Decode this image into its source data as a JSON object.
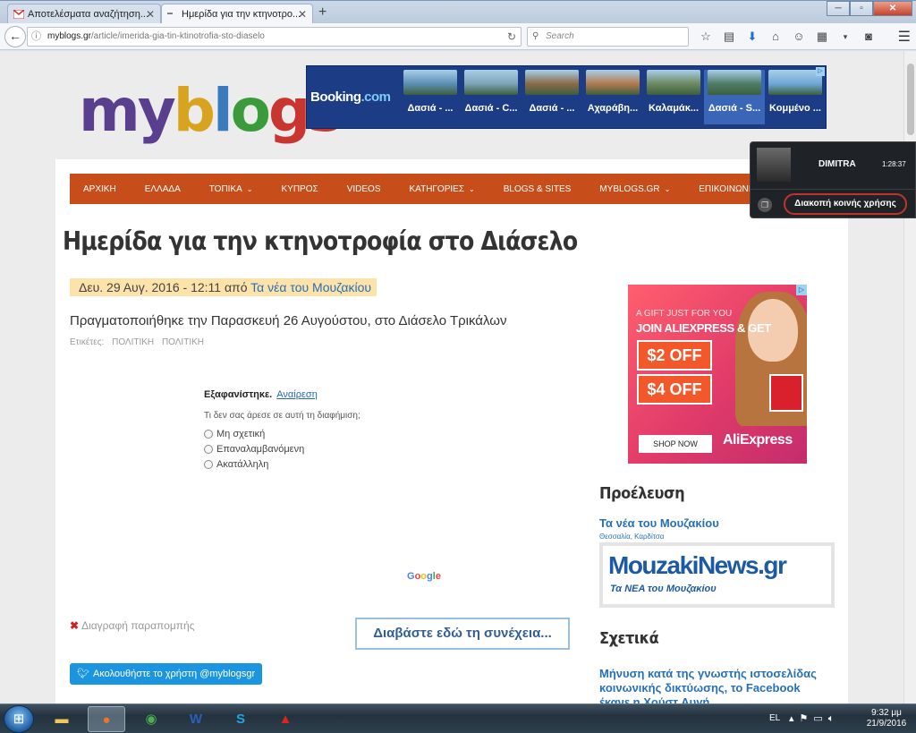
{
  "browser": {
    "tabs": [
      {
        "title": "Αποτελέσματα αναζήτηση...",
        "active": false
      },
      {
        "title": "Ημερίδα για την κτηνοτρο...",
        "active": true
      }
    ],
    "new_tab": "+",
    "url_domain": "myblogs.gr",
    "url_path": "/article/imerida-gia-tin-ktinotrofia-sto-diaselo",
    "search_placeholder": "Search",
    "window_buttons": [
      "─",
      "▫",
      "✕"
    ]
  },
  "site": {
    "logo_parts": [
      "my",
      "b",
      "l",
      "o",
      "gs"
    ]
  },
  "booking_ad": {
    "brand_main": "Booking",
    "brand_tld": ".com",
    "hotels": [
      {
        "label": "Δασιά - ...",
        "color": "#5d8fb5"
      },
      {
        "label": "Δασιά - C...",
        "color": "#7da4b8"
      },
      {
        "label": "Δασιά - ...",
        "color": "#8b6b4a"
      },
      {
        "label": "Αχαράβη...",
        "color": "#b47a4f"
      },
      {
        "label": "Καλαμάκ...",
        "color": "#6d8a62"
      },
      {
        "label": "Δασιά - S...",
        "color": "#4f7d6a"
      },
      {
        "label": "Κομμένο ...",
        "color": "#6fa8d8"
      }
    ]
  },
  "nav": {
    "items": [
      {
        "label": "ΑΡΧΙΚΗ",
        "dropdown": false
      },
      {
        "label": "ΕΛΛΑΔΑ",
        "dropdown": false
      },
      {
        "label": "ΤΟΠΙΚΑ",
        "dropdown": true
      },
      {
        "label": "ΚΥΠΡΟΣ",
        "dropdown": false
      },
      {
        "label": "VIDEOS",
        "dropdown": false
      },
      {
        "label": "ΚΑΤΗΓΟΡΙΕΣ",
        "dropdown": true
      },
      {
        "label": "BLOGS & SITES",
        "dropdown": false
      },
      {
        "label": "MYBLOGS.GR",
        "dropdown": true
      },
      {
        "label": "ΕΠΙΚΟΙΝΩΝΙΑ",
        "dropdown": false
      }
    ]
  },
  "article": {
    "title": "Ημερίδα για την κτηνοτροφία στο Διάσελο",
    "date_prefix": "Δευ. 29 Αυγ. 2016 - 12:11 από ",
    "source": "Τα νέα του Μουζακίου",
    "lead": "Πραγματοποιήθηκε την Παρασκευή 26 Αυγούστου, στο Διάσελο Τρικάλων",
    "tags_label": "Ετικέτες:",
    "tags": [
      "ΠΟΛΙΤΙΚΗ",
      "ΠΟΛΙΤΙΚΗ"
    ],
    "remove_link": "Διαγραφή παραπομπής",
    "read_more": "Διαβάστε εδώ τη συνέχεια...",
    "twitter_follow": "Ακολουθήστε το χρήστη @myblogsgr"
  },
  "ad_feedback": {
    "dismissed": "Εξαφανίστηκε.",
    "undo": "Αναίρεση",
    "question": "Τι δεν σας άρεσε σε αυτή τη διαφήμιση;",
    "options": [
      "Μη σχετική",
      "Επαναλαμβανόμενη",
      "Ακατάλληλη"
    ],
    "google": [
      "G",
      "o",
      "o",
      "g",
      "l",
      "e"
    ]
  },
  "aliexpress_ad": {
    "line1": "A GIFT JUST FOR YOU",
    "line2": "JOIN ALIEXPRESS & GET",
    "coupon1": "$2 OFF",
    "coupon2": "$4 OFF",
    "shop": "SHOP NOW",
    "brand": "AliExpress"
  },
  "sidebar": {
    "source_heading": "Προέλευση",
    "source_name": "Τα νέα του Μουζακίου",
    "source_location": "Θεσσαλία, Καρδίτσα",
    "source_logo_main": "MouzakiNews.gr",
    "source_logo_sub": "Τα ΝΕΑ του Μουζακίου",
    "related_heading": "Σχετικά",
    "related_link": "Μήνυση κατά της γνωστής ιστοσελίδας κοινωνικής δικτύωσης, το Facebook έκανε η Χούστ Αυγή"
  },
  "screen_share": {
    "user": "DIMITRA",
    "time": "1:28:37",
    "stop_label": "Διακοπή κοινής χρήσης"
  },
  "taskbar": {
    "language": "EL",
    "time": "9:32 μμ",
    "date": "21/9/2016"
  },
  "colors": {
    "nav_bg": "#c74d1b",
    "link": "#2770b7",
    "meta_highlight": "#fde3a9"
  }
}
